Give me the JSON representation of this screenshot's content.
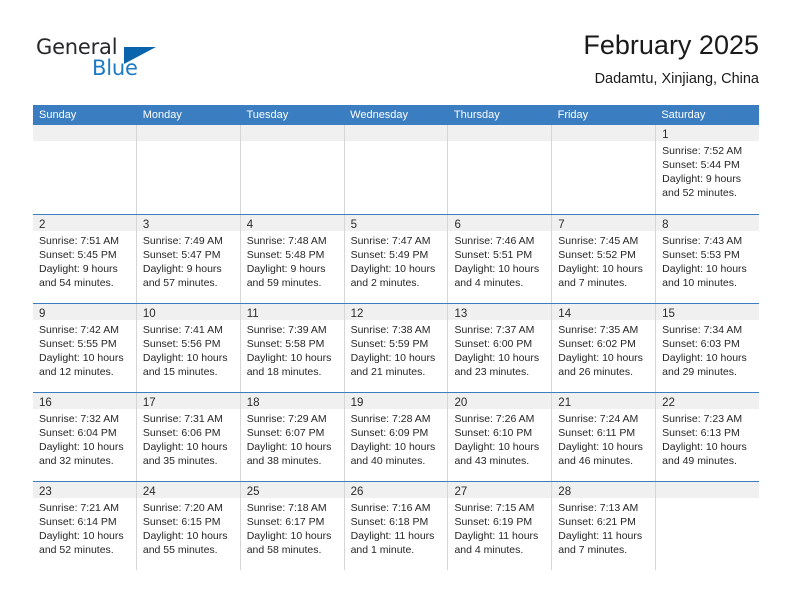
{
  "logo": {
    "word_top": "General",
    "word_bottom": "Blue",
    "accent_color": "#0a64ab",
    "blue_text_color": "#1f7ac4"
  },
  "header": {
    "title": "February 2025",
    "subtitle": "Dadamtu, Xinjiang, China"
  },
  "theme": {
    "header_blue": "#3a7dc0",
    "day_band_gray": "#f0f0f0",
    "cell_border": "#d6d6d6"
  },
  "weekdays": [
    "Sunday",
    "Monday",
    "Tuesday",
    "Wednesday",
    "Thursday",
    "Friday",
    "Saturday"
  ],
  "weeks": [
    [
      {
        "day": "",
        "l1": "",
        "l2": "",
        "l3": "",
        "l4": ""
      },
      {
        "day": "",
        "l1": "",
        "l2": "",
        "l3": "",
        "l4": ""
      },
      {
        "day": "",
        "l1": "",
        "l2": "",
        "l3": "",
        "l4": ""
      },
      {
        "day": "",
        "l1": "",
        "l2": "",
        "l3": "",
        "l4": ""
      },
      {
        "day": "",
        "l1": "",
        "l2": "",
        "l3": "",
        "l4": ""
      },
      {
        "day": "",
        "l1": "",
        "l2": "",
        "l3": "",
        "l4": ""
      },
      {
        "day": "1",
        "l1": "Sunrise: 7:52 AM",
        "l2": "Sunset: 5:44 PM",
        "l3": "Daylight: 9 hours",
        "l4": "and 52 minutes."
      }
    ],
    [
      {
        "day": "2",
        "l1": "Sunrise: 7:51 AM",
        "l2": "Sunset: 5:45 PM",
        "l3": "Daylight: 9 hours",
        "l4": "and 54 minutes."
      },
      {
        "day": "3",
        "l1": "Sunrise: 7:49 AM",
        "l2": "Sunset: 5:47 PM",
        "l3": "Daylight: 9 hours",
        "l4": "and 57 minutes."
      },
      {
        "day": "4",
        "l1": "Sunrise: 7:48 AM",
        "l2": "Sunset: 5:48 PM",
        "l3": "Daylight: 9 hours",
        "l4": "and 59 minutes."
      },
      {
        "day": "5",
        "l1": "Sunrise: 7:47 AM",
        "l2": "Sunset: 5:49 PM",
        "l3": "Daylight: 10 hours",
        "l4": "and 2 minutes."
      },
      {
        "day": "6",
        "l1": "Sunrise: 7:46 AM",
        "l2": "Sunset: 5:51 PM",
        "l3": "Daylight: 10 hours",
        "l4": "and 4 minutes."
      },
      {
        "day": "7",
        "l1": "Sunrise: 7:45 AM",
        "l2": "Sunset: 5:52 PM",
        "l3": "Daylight: 10 hours",
        "l4": "and 7 minutes."
      },
      {
        "day": "8",
        "l1": "Sunrise: 7:43 AM",
        "l2": "Sunset: 5:53 PM",
        "l3": "Daylight: 10 hours",
        "l4": "and 10 minutes."
      }
    ],
    [
      {
        "day": "9",
        "l1": "Sunrise: 7:42 AM",
        "l2": "Sunset: 5:55 PM",
        "l3": "Daylight: 10 hours",
        "l4": "and 12 minutes."
      },
      {
        "day": "10",
        "l1": "Sunrise: 7:41 AM",
        "l2": "Sunset: 5:56 PM",
        "l3": "Daylight: 10 hours",
        "l4": "and 15 minutes."
      },
      {
        "day": "11",
        "l1": "Sunrise: 7:39 AM",
        "l2": "Sunset: 5:58 PM",
        "l3": "Daylight: 10 hours",
        "l4": "and 18 minutes."
      },
      {
        "day": "12",
        "l1": "Sunrise: 7:38 AM",
        "l2": "Sunset: 5:59 PM",
        "l3": "Daylight: 10 hours",
        "l4": "and 21 minutes."
      },
      {
        "day": "13",
        "l1": "Sunrise: 7:37 AM",
        "l2": "Sunset: 6:00 PM",
        "l3": "Daylight: 10 hours",
        "l4": "and 23 minutes."
      },
      {
        "day": "14",
        "l1": "Sunrise: 7:35 AM",
        "l2": "Sunset: 6:02 PM",
        "l3": "Daylight: 10 hours",
        "l4": "and 26 minutes."
      },
      {
        "day": "15",
        "l1": "Sunrise: 7:34 AM",
        "l2": "Sunset: 6:03 PM",
        "l3": "Daylight: 10 hours",
        "l4": "and 29 minutes."
      }
    ],
    [
      {
        "day": "16",
        "l1": "Sunrise: 7:32 AM",
        "l2": "Sunset: 6:04 PM",
        "l3": "Daylight: 10 hours",
        "l4": "and 32 minutes."
      },
      {
        "day": "17",
        "l1": "Sunrise: 7:31 AM",
        "l2": "Sunset: 6:06 PM",
        "l3": "Daylight: 10 hours",
        "l4": "and 35 minutes."
      },
      {
        "day": "18",
        "l1": "Sunrise: 7:29 AM",
        "l2": "Sunset: 6:07 PM",
        "l3": "Daylight: 10 hours",
        "l4": "and 38 minutes."
      },
      {
        "day": "19",
        "l1": "Sunrise: 7:28 AM",
        "l2": "Sunset: 6:09 PM",
        "l3": "Daylight: 10 hours",
        "l4": "and 40 minutes."
      },
      {
        "day": "20",
        "l1": "Sunrise: 7:26 AM",
        "l2": "Sunset: 6:10 PM",
        "l3": "Daylight: 10 hours",
        "l4": "and 43 minutes."
      },
      {
        "day": "21",
        "l1": "Sunrise: 7:24 AM",
        "l2": "Sunset: 6:11 PM",
        "l3": "Daylight: 10 hours",
        "l4": "and 46 minutes."
      },
      {
        "day": "22",
        "l1": "Sunrise: 7:23 AM",
        "l2": "Sunset: 6:13 PM",
        "l3": "Daylight: 10 hours",
        "l4": "and 49 minutes."
      }
    ],
    [
      {
        "day": "23",
        "l1": "Sunrise: 7:21 AM",
        "l2": "Sunset: 6:14 PM",
        "l3": "Daylight: 10 hours",
        "l4": "and 52 minutes."
      },
      {
        "day": "24",
        "l1": "Sunrise: 7:20 AM",
        "l2": "Sunset: 6:15 PM",
        "l3": "Daylight: 10 hours",
        "l4": "and 55 minutes."
      },
      {
        "day": "25",
        "l1": "Sunrise: 7:18 AM",
        "l2": "Sunset: 6:17 PM",
        "l3": "Daylight: 10 hours",
        "l4": "and 58 minutes."
      },
      {
        "day": "26",
        "l1": "Sunrise: 7:16 AM",
        "l2": "Sunset: 6:18 PM",
        "l3": "Daylight: 11 hours",
        "l4": "and 1 minute."
      },
      {
        "day": "27",
        "l1": "Sunrise: 7:15 AM",
        "l2": "Sunset: 6:19 PM",
        "l3": "Daylight: 11 hours",
        "l4": "and 4 minutes."
      },
      {
        "day": "28",
        "l1": "Sunrise: 7:13 AM",
        "l2": "Sunset: 6:21 PM",
        "l3": "Daylight: 11 hours",
        "l4": "and 7 minutes."
      },
      {
        "day": "",
        "l1": "",
        "l2": "",
        "l3": "",
        "l4": ""
      }
    ]
  ]
}
